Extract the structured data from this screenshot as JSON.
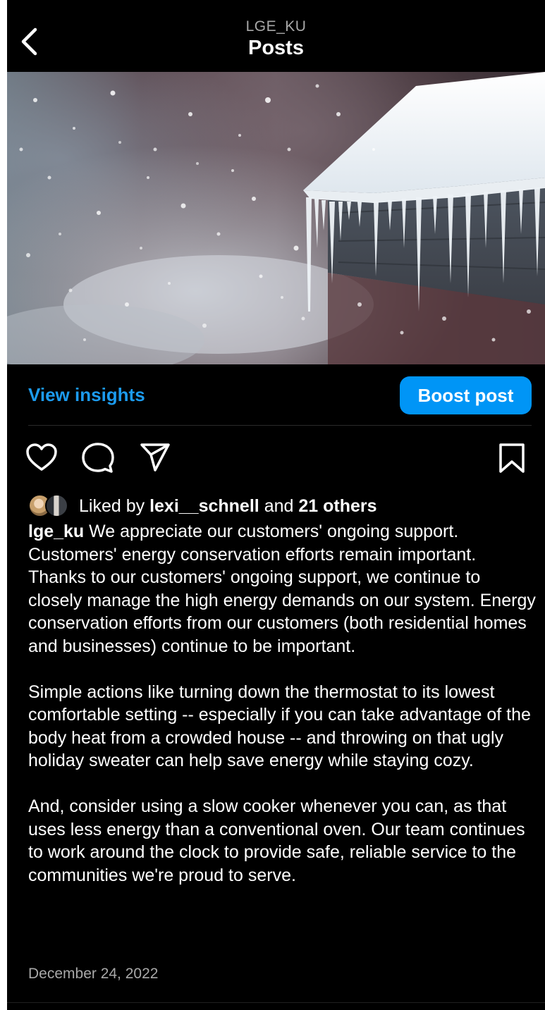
{
  "header": {
    "account": "LGE_KU",
    "title": "Posts",
    "back_icon": "chevron-left-icon"
  },
  "post": {
    "image_subject": "snow-covered roof with icicles in falling snow",
    "insights_label": "View insights",
    "boost_label": "Boost post",
    "actions": {
      "like_icon": "heart-icon",
      "comment_icon": "comment-icon",
      "share_icon": "send-icon",
      "save_icon": "bookmark-icon"
    },
    "likes": {
      "prefix": "Liked by",
      "user": "lexi__schnell",
      "conjunction": "and",
      "others": "21 others"
    },
    "caption": {
      "username": "lge_ku",
      "paragraphs": [
        "We appreciate our customers' ongoing support. Customers' energy conservation efforts remain important. Thanks to our customers' ongoing support, we continue to closely manage the high energy demands on our system. Energy conservation efforts from our customers (both residential homes and businesses) continue to be important.",
        "Simple actions like turning down the thermostat to its lowest comfortable setting -- especially if you can take advantage of the body heat from a crowded house -- and throwing on that ugly holiday sweater can help save energy while staying cozy.",
        "And, consider using a slow cooker whenever you can, as that uses less energy than a conventional oven. Our team continues to work around the clock to provide safe, reliable service to the communities we're proud to serve."
      ]
    },
    "date": "December 24, 2022"
  },
  "colors": {
    "background": "#000000",
    "accent": "#0095f6",
    "link": "#1c9bef",
    "muted": "#a8a8a8"
  }
}
